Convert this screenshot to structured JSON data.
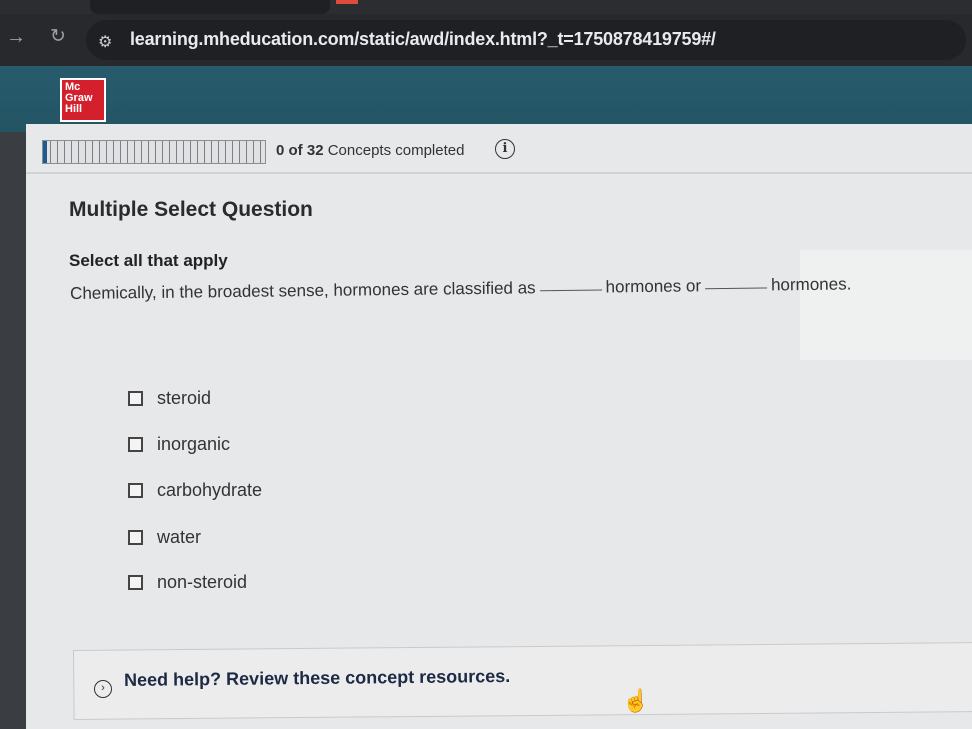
{
  "browser": {
    "url": "learning.mheducation.com/static/awd/index.html?_t=1750878419759#/",
    "icons": {
      "forward": "arrow-right-icon",
      "reload": "reload-icon",
      "site_info": "site-settings-icon"
    }
  },
  "brand": {
    "logo_lines": [
      "Mc",
      "Graw",
      "Hill"
    ],
    "header_color": "#285b6c",
    "logo_color": "#d4202c"
  },
  "progress": {
    "completed": "0",
    "of_label": "of",
    "total": "32",
    "label": "Concepts completed",
    "fraction": 0.0
  },
  "question": {
    "type": "Multiple Select Question",
    "instruction": "Select all that apply",
    "prompt_part1": "Chemically, in the broadest sense, hormones are classified as",
    "prompt_part2": "hormones or",
    "prompt_part3": "hormones.",
    "options": [
      {
        "label": "steroid",
        "checked": false
      },
      {
        "label": "inorganic",
        "checked": false
      },
      {
        "label": "carbohydrate",
        "checked": false
      },
      {
        "label": "water",
        "checked": false
      },
      {
        "label": "non-steroid",
        "checked": false
      }
    ]
  },
  "help": {
    "label": "Need help? Review these concept resources.",
    "icon": "chevron-right-circle-icon"
  }
}
